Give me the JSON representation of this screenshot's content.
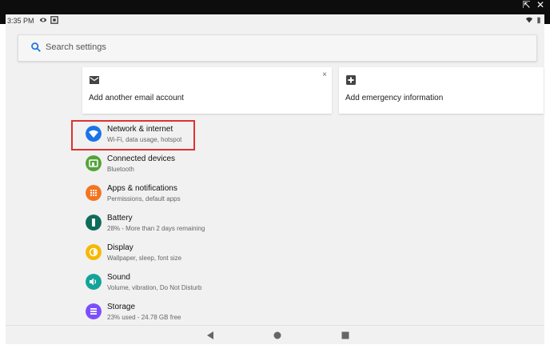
{
  "statusbar": {
    "time": "3:35 PM"
  },
  "window_controls": {
    "open_label": "⇱",
    "close_label": "✕"
  },
  "search": {
    "placeholder": "Search settings"
  },
  "suggestions": [
    {
      "label": "Add another email account",
      "icon": "email-icon",
      "dismiss": "×"
    },
    {
      "label": "Add emergency information",
      "icon": "plus-box-icon"
    }
  ],
  "settings": [
    {
      "title": "Network & internet",
      "subtitle": "Wi-Fi, data usage, hotspot",
      "icon": "wifi-icon",
      "color": "#1a73e8"
    },
    {
      "title": "Connected devices",
      "subtitle": "Bluetooth",
      "icon": "devices-icon",
      "color": "#53a33a"
    },
    {
      "title": "Apps & notifications",
      "subtitle": "Permissions, default apps",
      "icon": "apps-icon",
      "color": "#f37520"
    },
    {
      "title": "Battery",
      "subtitle": "28% - More than 2 days remaining",
      "icon": "battery-icon",
      "color": "#0f6b5a"
    },
    {
      "title": "Display",
      "subtitle": "Wallpaper, sleep, font size",
      "icon": "brightness-icon",
      "color": "#f6b800"
    },
    {
      "title": "Sound",
      "subtitle": "Volume, vibration, Do Not Disturb",
      "icon": "volume-icon",
      "color": "#12a39a"
    },
    {
      "title": "Storage",
      "subtitle": "23% used - 24.78 GB free",
      "icon": "storage-icon",
      "color": "#7c4dff"
    }
  ],
  "navbar": {
    "back": "back-icon",
    "home": "home-icon",
    "recents": "recents-icon"
  }
}
